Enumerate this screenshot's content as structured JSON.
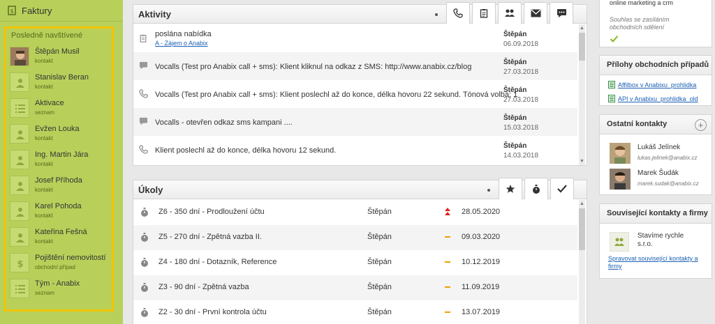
{
  "sidebar": {
    "top_label": "Faktury",
    "recent_title": "Posledně navštívené",
    "items": [
      {
        "name": "Štěpán Musil",
        "type": "kontakt",
        "icon": "person-photo-icon"
      },
      {
        "name": "Stanislav Beran",
        "type": "kontakt",
        "icon": "person-icon"
      },
      {
        "name": "Aktivace",
        "type": "seznam",
        "icon": "list-icon"
      },
      {
        "name": "Evžen Louka",
        "type": "kontakt",
        "icon": "person-icon"
      },
      {
        "name": "Ing. Martin Jára",
        "type": "kontakt",
        "icon": "person-icon"
      },
      {
        "name": "Josef Příhoda",
        "type": "kontakt",
        "icon": "person-icon"
      },
      {
        "name": "Karel Pohoda",
        "type": "kontakt",
        "icon": "person-icon"
      },
      {
        "name": "Kateřina Fešná",
        "type": "kontakt",
        "icon": "person-icon"
      },
      {
        "name": "Pojištění nemovitostí",
        "type": "obchodní případ",
        "icon": "dollar-icon"
      },
      {
        "name": "Tým - Anabix",
        "type": "seznam",
        "icon": "list-icon"
      }
    ]
  },
  "activities": {
    "title": "Aktivity",
    "tabs": [
      "phone-icon",
      "clipboard-icon",
      "people-icon",
      "mail-icon",
      "chat-icon"
    ],
    "rows": [
      {
        "text": "poslána nabídka",
        "link": "A - Zájem o Anabix",
        "who": "Štěpán",
        "date": "06.09.2018",
        "icon": "clipboard-icon"
      },
      {
        "text": "Vocalls (Test pro Anabix call + sms): Klient kliknul na odkaz z SMS: http://www.anabix.cz/blog",
        "link": "",
        "who": "Štěpán",
        "date": "27.03.2018",
        "icon": "chat-icon"
      },
      {
        "text": "Vocalls (Test pro Anabix call + sms): Klient poslechl až do konce, délka hovoru 22 sekund. Tónová volba: 1",
        "link": "",
        "who": "Štěpán",
        "date": "27.03.2018",
        "icon": "phone-icon"
      },
      {
        "text": "Vocalls - otevřen odkaz sms kampani ....",
        "link": "",
        "who": "Štěpán",
        "date": "15.03.2018",
        "icon": "chat-icon"
      },
      {
        "text": "Klient poslechl až do konce, délka hovoru 12 sekund.",
        "link": "",
        "who": "Štěpán",
        "date": "14.03.2018",
        "icon": "phone-icon"
      }
    ]
  },
  "tasks": {
    "title": "Úkoly",
    "tabs": [
      "star-icon",
      "stopwatch-icon",
      "check-icon"
    ],
    "rows": [
      {
        "text": "Z6 - 350 dní - Prodloužení účtu",
        "who": "Štěpán",
        "priority": "high",
        "date": "28.05.2020"
      },
      {
        "text": "Z5 - 270 dní - Zpětná vazba II.",
        "who": "Štěpán",
        "priority": "normal",
        "date": "09.03.2020"
      },
      {
        "text": "Z4 - 180 dní - Dotazník, Reference",
        "who": "Štěpán",
        "priority": "normal",
        "date": "10.12.2019"
      },
      {
        "text": "Z3 - 90 dní - Zpětná vazba",
        "who": "Štěpán",
        "priority": "normal",
        "date": "11.09.2019"
      },
      {
        "text": "Z2 - 30 dní - První kontrola účtu",
        "who": "Štěpán",
        "priority": "normal",
        "date": "13.07.2019"
      }
    ]
  },
  "right": {
    "consent_top": "online marketing a crm",
    "consent_text": "Souhlas se zasíláním obchodních sdělení",
    "attachments_title": "Přílohy obchodních případů",
    "attachments": [
      "Affilbox v Anabixu_prohlidka",
      "API v Anabixu_prohlidka_old"
    ],
    "other_contacts_title": "Ostatní kontakty",
    "other_contacts": [
      {
        "name": "Lukáš Jelínek",
        "email": "lukas.jelinek@anabix.cz"
      },
      {
        "name": "Marek Šudák",
        "email": "marek.sudak@anabix.cz"
      }
    ],
    "related_title": "Související kontakty a firmy",
    "related_company": "Stavíme rychle s.r.o.",
    "related_link": "Spravovat související kontakty a firmy"
  },
  "colors": {
    "sidebar_bg": "#b8d05a",
    "highlight": "#f3c300",
    "link": "#1a5fb4",
    "priority_high": "#e02020",
    "priority_normal": "#f0a000"
  }
}
